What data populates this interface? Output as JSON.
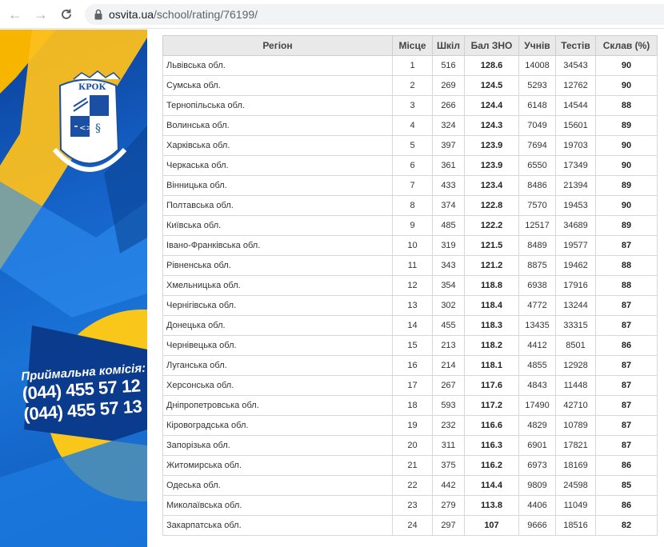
{
  "browser": {
    "url_host": "osvita.ua",
    "url_path": "/school/rating/76199/"
  },
  "icons": {
    "back": "arrow-left-icon",
    "forward": "arrow-right-icon",
    "reload": "reload-icon",
    "lock": "lock-icon"
  },
  "banner": {
    "logo_text": "КРОК",
    "promo_title": "Приймальна комісія:",
    "phone_1": "(044) 455 57 12",
    "phone_2": "(044) 455 57 13",
    "colors": {
      "blue": "#1563c9",
      "yellow": "#f7b500"
    }
  },
  "table": {
    "headers": [
      "Регіон",
      "Місце",
      "Шкіл",
      "Бал ЗНО",
      "Учнів",
      "Тестів",
      "Склав (%)"
    ],
    "rows": [
      [
        "Львівська обл.",
        "1",
        "516",
        "128.6",
        "14008",
        "34543",
        "90"
      ],
      [
        "Сумська обл.",
        "2",
        "269",
        "124.5",
        "5293",
        "12762",
        "90"
      ],
      [
        "Тернопільська обл.",
        "3",
        "266",
        "124.4",
        "6148",
        "14544",
        "88"
      ],
      [
        "Волинська обл.",
        "4",
        "324",
        "124.3",
        "7049",
        "15601",
        "89"
      ],
      [
        "Харківська обл.",
        "5",
        "397",
        "123.9",
        "7694",
        "19703",
        "90"
      ],
      [
        "Черкаська обл.",
        "6",
        "361",
        "123.9",
        "6550",
        "17349",
        "90"
      ],
      [
        "Вінницька обл.",
        "7",
        "433",
        "123.4",
        "8486",
        "21394",
        "89"
      ],
      [
        "Полтавська обл.",
        "8",
        "374",
        "122.8",
        "7570",
        "19453",
        "90"
      ],
      [
        "Київська обл.",
        "9",
        "485",
        "122.2",
        "12517",
        "34689",
        "89"
      ],
      [
        "Івано-Франківська обл.",
        "10",
        "319",
        "121.5",
        "8489",
        "19577",
        "87"
      ],
      [
        "Рівненська обл.",
        "11",
        "343",
        "121.2",
        "8875",
        "19462",
        "88"
      ],
      [
        "Хмельницька обл.",
        "12",
        "354",
        "118.8",
        "6938",
        "17916",
        "88"
      ],
      [
        "Чернігівська обл.",
        "13",
        "302",
        "118.4",
        "4772",
        "13244",
        "87"
      ],
      [
        "Донецька обл.",
        "14",
        "455",
        "118.3",
        "13435",
        "33315",
        "87"
      ],
      [
        "Чернівецька обл.",
        "15",
        "213",
        "118.2",
        "4412",
        "8501",
        "86"
      ],
      [
        "Луганська обл.",
        "16",
        "214",
        "118.1",
        "4855",
        "12928",
        "87"
      ],
      [
        "Херсонська обл.",
        "17",
        "267",
        "117.6",
        "4843",
        "11448",
        "87"
      ],
      [
        "Дніпропетровська обл.",
        "18",
        "593",
        "117.2",
        "17490",
        "42710",
        "87"
      ],
      [
        "Кіровоградська обл.",
        "19",
        "232",
        "116.6",
        "4829",
        "10789",
        "87"
      ],
      [
        "Запорізька обл.",
        "20",
        "311",
        "116.3",
        "6901",
        "17821",
        "87"
      ],
      [
        "Житомирська обл.",
        "21",
        "375",
        "116.2",
        "6973",
        "18169",
        "86"
      ],
      [
        "Одеська обл.",
        "22",
        "442",
        "114.4",
        "9809",
        "24598",
        "85"
      ],
      [
        "Миколаївська обл.",
        "23",
        "279",
        "113.8",
        "4406",
        "11049",
        "86"
      ],
      [
        "Закарпатська обл.",
        "24",
        "297",
        "107",
        "9666",
        "18516",
        "82"
      ]
    ]
  }
}
